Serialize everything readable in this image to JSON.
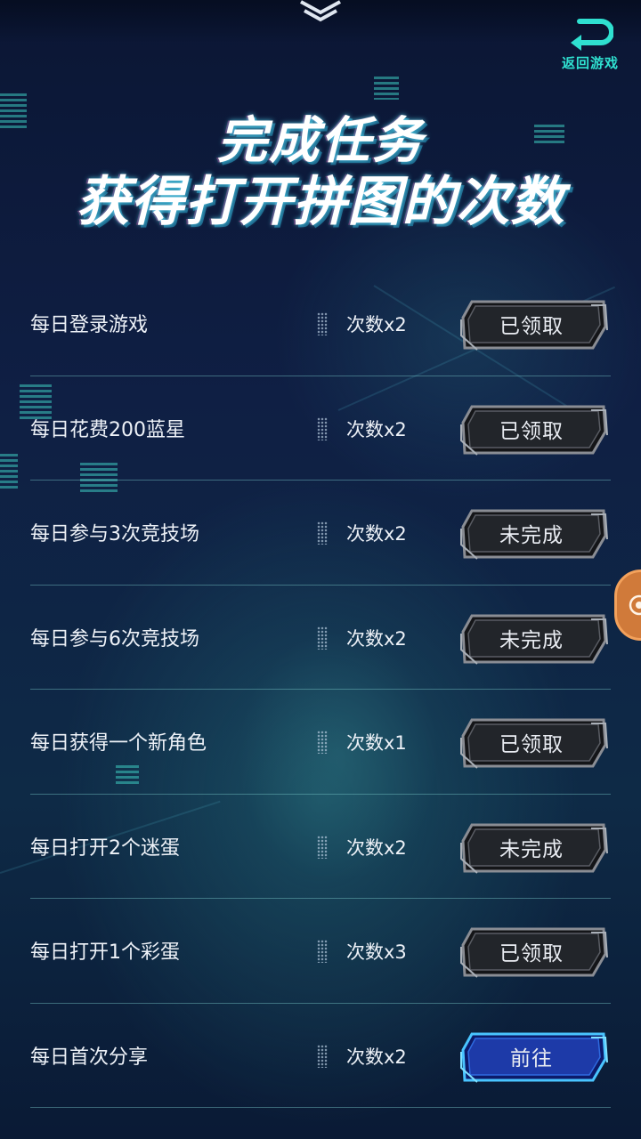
{
  "header": {
    "back_label": "返回游戏",
    "title_line1": "完成任务",
    "title_line2": "获得打开拼图的次数"
  },
  "icons": {
    "top": "chevron-double-down-icon",
    "back": "return-arrow-icon",
    "side": "game-pad-icon"
  },
  "colors": {
    "accent": "#2fe0d0",
    "background": "#0f1f44",
    "button_dark": "#1e2024",
    "button_blue": "#1d3aa8",
    "side_button": "#d07a3a"
  },
  "tasks": [
    {
      "name": "每日登录游戏",
      "reward": "次数x2",
      "button": "已领取",
      "style": "dark"
    },
    {
      "name": "每日花费200蓝星",
      "reward": "次数x2",
      "button": "已领取",
      "style": "dark"
    },
    {
      "name": "每日参与3次竞技场",
      "reward": "次数x2",
      "button": "未完成",
      "style": "dark"
    },
    {
      "name": "每日参与6次竞技场",
      "reward": "次数x2",
      "button": "未完成",
      "style": "dark"
    },
    {
      "name": "每日获得一个新角色",
      "reward": "次数x1",
      "button": "已领取",
      "style": "dark"
    },
    {
      "name": "每日打开2个迷蛋",
      "reward": "次数x2",
      "button": "未完成",
      "style": "dark"
    },
    {
      "name": "每日打开1个彩蛋",
      "reward": "次数x3",
      "button": "已领取",
      "style": "dark"
    },
    {
      "name": "每日首次分享",
      "reward": "次数x2",
      "button": "前往",
      "style": "blue"
    }
  ]
}
